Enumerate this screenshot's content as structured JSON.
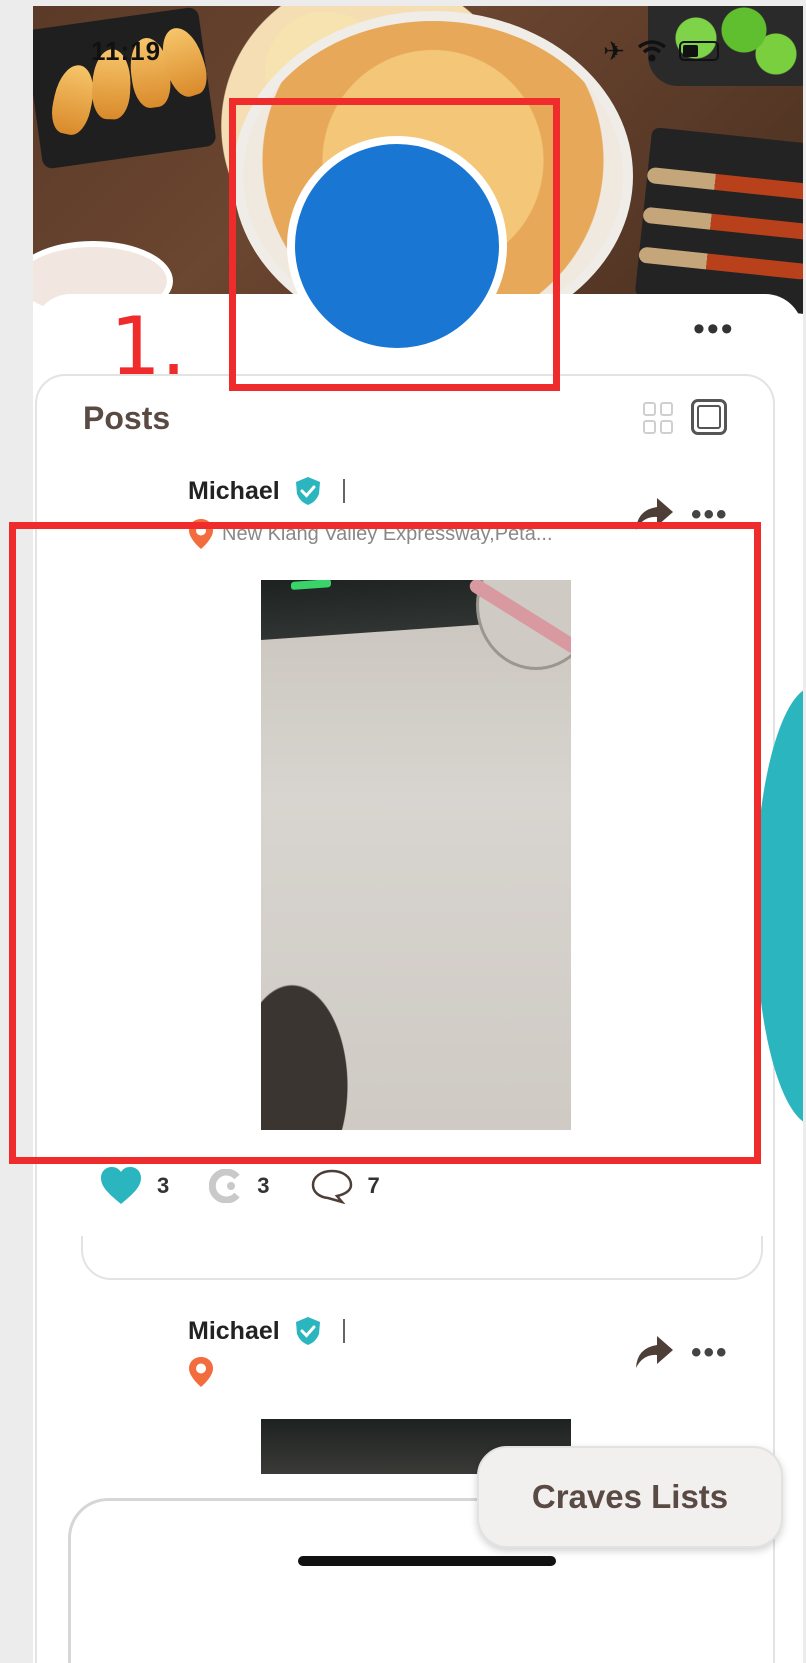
{
  "status_bar": {
    "time": "11:19"
  },
  "annotation": {
    "label": "1.",
    "color": "#ef2b2b"
  },
  "profile": {
    "avatar_color": "#1976d2"
  },
  "posts_section": {
    "title": "Posts",
    "view_modes": [
      "grid-view-icon",
      "single-view-icon"
    ],
    "selected_view": "single"
  },
  "posts": [
    {
      "author": "Michael",
      "verified": true,
      "location": "New Klang Valley Expressway,Peta...",
      "likes": "3",
      "recraves": "3",
      "comments": "7"
    },
    {
      "author": "Michael",
      "verified": true,
      "location": ""
    }
  ],
  "floating_button": {
    "label": "Craves Lists"
  },
  "colors": {
    "accent": "#2ab5bf",
    "pin": "#f36c3d",
    "text_brown": "#5a4a44"
  }
}
